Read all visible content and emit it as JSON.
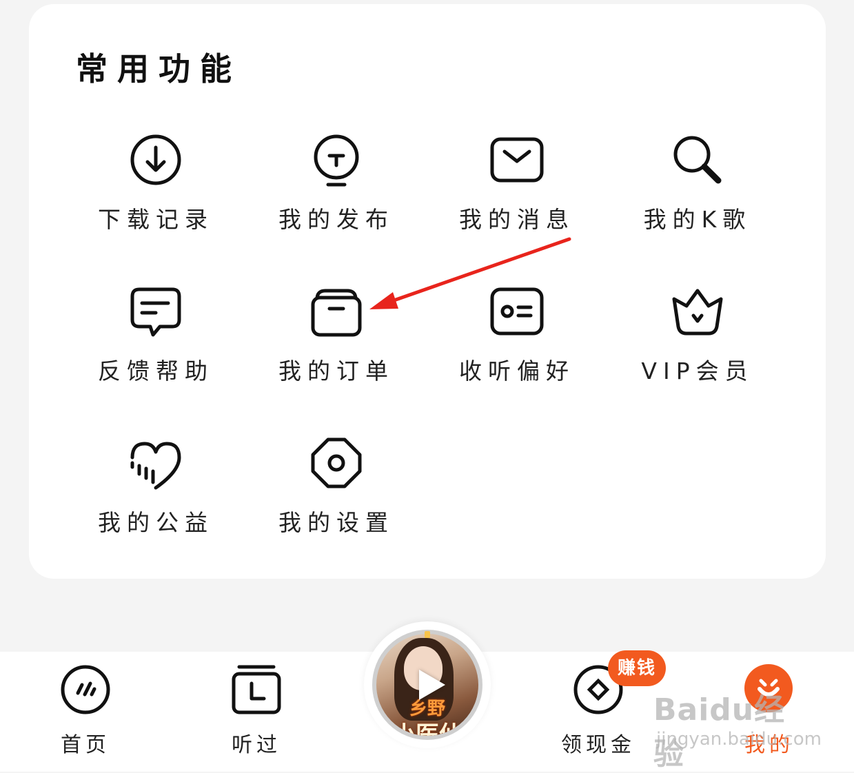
{
  "section": {
    "title": "常用功能"
  },
  "functions": [
    {
      "label": "下载记录",
      "icon": "download-icon"
    },
    {
      "label": "我的发布",
      "icon": "lightbulb-icon"
    },
    {
      "label": "我的消息",
      "icon": "envelope-icon"
    },
    {
      "label": "我的K歌",
      "icon": "karaoke-search-icon"
    },
    {
      "label": "反馈帮助",
      "icon": "message-bubble-icon"
    },
    {
      "label": "我的订单",
      "icon": "archive-box-icon"
    },
    {
      "label": "收听偏好",
      "icon": "id-card-icon"
    },
    {
      "label": "VIP会员",
      "icon": "crown-icon"
    },
    {
      "label": "我的公益",
      "icon": "heart-icon"
    },
    {
      "label": "我的设置",
      "icon": "settings-hexagon-icon"
    }
  ],
  "annotation": {
    "arrow_color": "#e8241c",
    "points_to": "我的订单"
  },
  "bottom_nav": {
    "home": {
      "label": "首页",
      "icon": "home-dial-icon"
    },
    "history": {
      "label": "听过",
      "icon": "history-clock-icon"
    },
    "player": {
      "book_title_line1": "乡野",
      "book_title_line2": "小医仙",
      "icon": "play-icon"
    },
    "cash": {
      "label": "领现金",
      "icon": "coin-icon",
      "badge": "赚钱"
    },
    "me": {
      "label": "我的",
      "icon": "profile-smile-icon",
      "active": true
    }
  },
  "watermark": {
    "main": "Baidu经验",
    "sub": "jingyan.baidu.com"
  },
  "colors": {
    "accent": "#f25a1f",
    "background": "#f4f4f4",
    "card": "#ffffff"
  }
}
